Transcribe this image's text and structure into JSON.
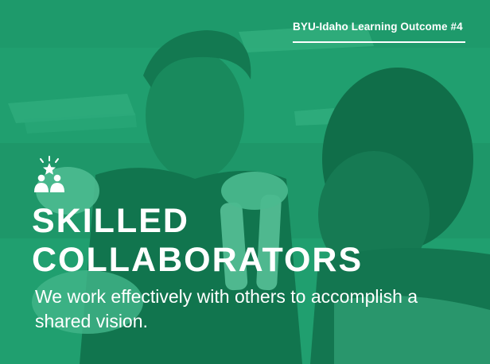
{
  "outcome_label": "BYU-Idaho Learning Outcome #4",
  "headline": {
    "line1": "SKILLED",
    "line2": "COLLABORATORS"
  },
  "tagline": "We work effectively with others to accomplish a shared vision.",
  "icon": "two-people-with-star-icon",
  "colors": {
    "overlay_green": "#1f9a6c",
    "text": "#ffffff"
  }
}
